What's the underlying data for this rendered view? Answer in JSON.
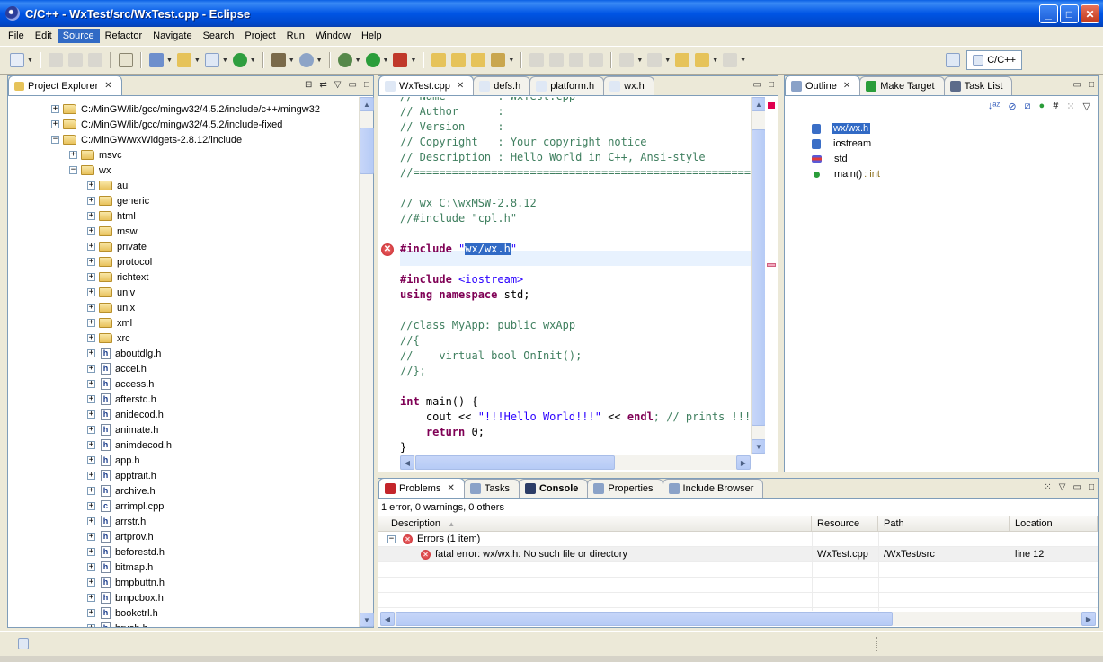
{
  "window": {
    "title": "C/C++ - WxTest/src/WxTest.cpp - Eclipse",
    "min": "_",
    "max": "□",
    "close": "✕"
  },
  "menu": [
    "File",
    "Edit",
    "Source",
    "Refactor",
    "Navigate",
    "Search",
    "Project",
    "Run",
    "Window",
    "Help"
  ],
  "menu_active": "Source",
  "perspective": {
    "label": "C/C++"
  },
  "explorer": {
    "tab": "Project Explorer",
    "tree": [
      {
        "depth": 0,
        "exp": "+",
        "kind": "folder",
        "label": "C:/MinGW/lib/gcc/mingw32/4.5.2/include/c++/mingw32"
      },
      {
        "depth": 0,
        "exp": "+",
        "kind": "folder",
        "label": "C:/MinGW/lib/gcc/mingw32/4.5.2/include-fixed"
      },
      {
        "depth": 0,
        "exp": "−",
        "kind": "folder",
        "label": "C:/MinGW/wxWidgets-2.8.12/include"
      },
      {
        "depth": 1,
        "exp": "+",
        "kind": "folder",
        "label": "msvc"
      },
      {
        "depth": 1,
        "exp": "−",
        "kind": "folder",
        "label": "wx"
      },
      {
        "depth": 2,
        "exp": "+",
        "kind": "folder",
        "label": "aui"
      },
      {
        "depth": 2,
        "exp": "+",
        "kind": "folder",
        "label": "generic"
      },
      {
        "depth": 2,
        "exp": "+",
        "kind": "folder",
        "label": "html"
      },
      {
        "depth": 2,
        "exp": "+",
        "kind": "folder",
        "label": "msw"
      },
      {
        "depth": 2,
        "exp": "+",
        "kind": "folder",
        "label": "private"
      },
      {
        "depth": 2,
        "exp": "+",
        "kind": "folder",
        "label": "protocol"
      },
      {
        "depth": 2,
        "exp": "+",
        "kind": "folder",
        "label": "richtext"
      },
      {
        "depth": 2,
        "exp": "+",
        "kind": "folder",
        "label": "univ"
      },
      {
        "depth": 2,
        "exp": "+",
        "kind": "folder",
        "label": "unix"
      },
      {
        "depth": 2,
        "exp": "+",
        "kind": "folder",
        "label": "xml"
      },
      {
        "depth": 2,
        "exp": "+",
        "kind": "folder",
        "label": "xrc"
      },
      {
        "depth": 2,
        "exp": "+",
        "kind": "h",
        "label": "aboutdlg.h"
      },
      {
        "depth": 2,
        "exp": "+",
        "kind": "h",
        "label": "accel.h"
      },
      {
        "depth": 2,
        "exp": "+",
        "kind": "h",
        "label": "access.h"
      },
      {
        "depth": 2,
        "exp": "+",
        "kind": "h",
        "label": "afterstd.h"
      },
      {
        "depth": 2,
        "exp": "+",
        "kind": "h",
        "label": "anidecod.h"
      },
      {
        "depth": 2,
        "exp": "+",
        "kind": "h",
        "label": "animate.h"
      },
      {
        "depth": 2,
        "exp": "+",
        "kind": "h",
        "label": "animdecod.h"
      },
      {
        "depth": 2,
        "exp": "+",
        "kind": "h",
        "label": "app.h"
      },
      {
        "depth": 2,
        "exp": "+",
        "kind": "h",
        "label": "apptrait.h"
      },
      {
        "depth": 2,
        "exp": "+",
        "kind": "h",
        "label": "archive.h"
      },
      {
        "depth": 2,
        "exp": "+",
        "kind": "c",
        "label": "arrimpl.cpp"
      },
      {
        "depth": 2,
        "exp": "+",
        "kind": "h",
        "label": "arrstr.h"
      },
      {
        "depth": 2,
        "exp": "+",
        "kind": "h",
        "label": "artprov.h"
      },
      {
        "depth": 2,
        "exp": "+",
        "kind": "h",
        "label": "beforestd.h"
      },
      {
        "depth": 2,
        "exp": "+",
        "kind": "h",
        "label": "bitmap.h"
      },
      {
        "depth": 2,
        "exp": "+",
        "kind": "h",
        "label": "bmpbuttn.h"
      },
      {
        "depth": 2,
        "exp": "+",
        "kind": "h",
        "label": "bmpcbox.h"
      },
      {
        "depth": 2,
        "exp": "+",
        "kind": "h",
        "label": "bookctrl.h"
      },
      {
        "depth": 2,
        "exp": "+",
        "kind": "h",
        "label": "brush.h"
      }
    ]
  },
  "editor": {
    "tabs": [
      "WxTest.cpp",
      "defs.h",
      "platform.h",
      "wx.h"
    ],
    "active_tab": "WxTest.cpp",
    "lines": [
      [
        {
          "t": "// Name        : WxTest.cpp",
          "c": "com"
        }
      ],
      [
        {
          "t": "// Author      :",
          "c": "com"
        }
      ],
      [
        {
          "t": "// Version     :",
          "c": "com"
        }
      ],
      [
        {
          "t": "// Copyright   : Your copyright notice",
          "c": "com"
        }
      ],
      [
        {
          "t": "// Description : Hello World in C++, Ansi-style",
          "c": "com"
        }
      ],
      [
        {
          "t": "//============================================================",
          "c": "com"
        }
      ],
      [
        {
          "t": "",
          "c": ""
        }
      ],
      [
        {
          "t": "// wx C:\\wxMSW-2.8.12",
          "c": "com"
        }
      ],
      [
        {
          "t": "//#include \"cpl.h\"",
          "c": "com"
        }
      ],
      [
        {
          "t": "",
          "c": ""
        }
      ],
      [
        {
          "t": "#include ",
          "c": "kw"
        },
        {
          "t": "\"",
          "c": "str"
        },
        {
          "t": "wx/wx.h",
          "c": "sel"
        },
        {
          "t": "\"",
          "c": "str"
        }
      ],
      [
        {
          "t": "",
          "c": ""
        }
      ],
      [
        {
          "t": "#include ",
          "c": "kw"
        },
        {
          "t": "<iostream>",
          "c": "str"
        }
      ],
      [
        {
          "t": "using namespace ",
          "c": "kw"
        },
        {
          "t": "std;",
          "c": ""
        }
      ],
      [
        {
          "t": "",
          "c": ""
        }
      ],
      [
        {
          "t": "//class MyApp: public wxApp",
          "c": "com"
        }
      ],
      [
        {
          "t": "//{",
          "c": "com"
        }
      ],
      [
        {
          "t": "//    virtual bool OnInit();",
          "c": "com"
        }
      ],
      [
        {
          "t": "//};",
          "c": "com"
        }
      ],
      [
        {
          "t": "",
          "c": ""
        }
      ],
      [
        {
          "t": "int ",
          "c": "kw"
        },
        {
          "t": "main() {",
          "c": ""
        }
      ],
      [
        {
          "t": "    cout << ",
          "c": ""
        },
        {
          "t": "\"!!!Hello World!!!\"",
          "c": "str"
        },
        {
          "t": " << ",
          "c": ""
        },
        {
          "t": "endl",
          "c": "kw"
        },
        {
          "t": "; // prints !!!Hello World!!!",
          "c": "com"
        }
      ],
      [
        {
          "t": "    ",
          "c": ""
        },
        {
          "t": "return ",
          "c": "kw"
        },
        {
          "t": "0;",
          "c": ""
        }
      ],
      [
        {
          "t": "}",
          "c": ""
        }
      ]
    ]
  },
  "outline": {
    "tabs": [
      "Outline",
      "Make Target",
      "Task List"
    ],
    "items": [
      {
        "label": "wx/wx.h",
        "suffix": "",
        "kind": "include",
        "selected": true
      },
      {
        "label": "iostream",
        "suffix": "",
        "kind": "include",
        "selected": false
      },
      {
        "label": "std",
        "suffix": "",
        "kind": "namespace",
        "selected": false
      },
      {
        "label": "main()",
        "suffix": " : int",
        "kind": "function",
        "selected": false
      }
    ]
  },
  "problems": {
    "tabs": [
      "Problems",
      "Tasks",
      "Console",
      "Properties",
      "Include Browser"
    ],
    "summary": "1 error, 0 warnings, 0 others",
    "columns": [
      "Description",
      "Resource",
      "Path",
      "Location"
    ],
    "group": "Errors (1 item)",
    "rows": [
      {
        "description": "fatal error: wx/wx.h: No such file or directory",
        "resource": "WxTest.cpp",
        "path": "/WxTest/src",
        "location": "line 12"
      }
    ]
  },
  "colors": {
    "selection": "#316ac5",
    "comment": "#3f7f5f",
    "keyword": "#7f0055",
    "string": "#2a00ff",
    "error": "#c3252b"
  }
}
